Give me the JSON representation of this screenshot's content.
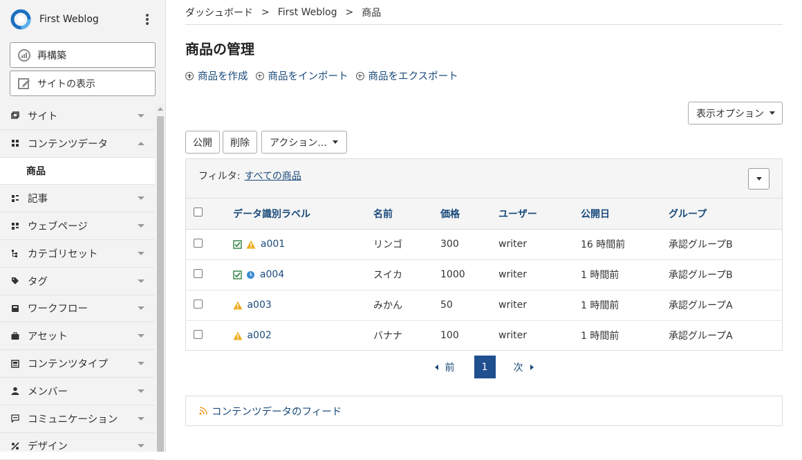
{
  "brand": {
    "site_name": "First Weblog"
  },
  "side_buttons": {
    "rebuild": "再構築",
    "view_site": "サイトの表示"
  },
  "menu": {
    "site": "サイト",
    "content_data": "コンテンツデータ",
    "products_sub": "商品",
    "entries": "記事",
    "pages": "ウェブページ",
    "category_sets": "カテゴリセット",
    "tags": "タグ",
    "workflow": "ワークフロー",
    "assets": "アセット",
    "content_types": "コンテンツタイプ",
    "members": "メンバー",
    "communication": "コミュニケーション",
    "design": "デザイン"
  },
  "breadcrumb": {
    "dashboard": "ダッシュボード",
    "weblog": "First Weblog",
    "current": "商品",
    "sep": ">"
  },
  "page_title": "商品の管理",
  "actions": {
    "create": "商品を作成",
    "import": "商品をインポート",
    "export": "商品をエクスポート"
  },
  "display_options": "表示オプション",
  "bulk": {
    "publish": "公開",
    "delete": "削除",
    "actions": "アクション..."
  },
  "filter": {
    "label": "フィルタ:",
    "value": "すべての商品"
  },
  "table": {
    "headers": {
      "label": "データ識別ラベル",
      "name": "名前",
      "price": "価格",
      "user": "ユーザー",
      "published": "公開日",
      "group": "グループ"
    },
    "rows": [
      {
        "label": "a001",
        "name": "リンゴ",
        "price": "300",
        "user": "writer",
        "published": "16 時間前",
        "group": "承認グループB",
        "status": [
          "check",
          "warning"
        ]
      },
      {
        "label": "a004",
        "name": "スイカ",
        "price": "1000",
        "user": "writer",
        "published": "1 時間前",
        "group": "承認グループB",
        "status": [
          "check",
          "clock"
        ]
      },
      {
        "label": "a003",
        "name": "みかん",
        "price": "50",
        "user": "writer",
        "published": "1 時間前",
        "group": "承認グループA",
        "status": [
          "warning"
        ]
      },
      {
        "label": "a002",
        "name": "バナナ",
        "price": "100",
        "user": "writer",
        "published": "1 時間前",
        "group": "承認グループA",
        "status": [
          "warning"
        ]
      }
    ]
  },
  "pager": {
    "prev": "前",
    "current": "1",
    "next": "次"
  },
  "feed": "コンテンツデータのフィード",
  "colors": {
    "link": "#1a4a7a",
    "warning": "#f0ad1e",
    "check": "#3a8a4a",
    "clock": "#3a8ad0",
    "rss": "#f0a030",
    "accent": "#1f4f8f"
  }
}
